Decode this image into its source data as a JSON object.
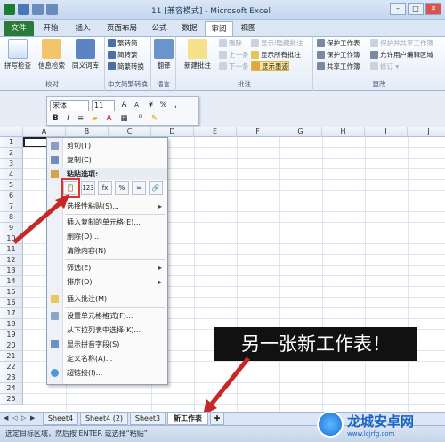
{
  "window": {
    "title": "11  [兼容模式] - Microsoft Excel",
    "min": "–",
    "max": "□",
    "close": "✕"
  },
  "tabs": [
    "文件",
    "开始",
    "插入",
    "页面布局",
    "公式",
    "数据",
    "审阅",
    "视图"
  ],
  "active_tab": "审阅",
  "ribbon": {
    "proofing": {
      "label": "校对",
      "buttons": [
        "拼写检查",
        "信息检索",
        "同义词库"
      ]
    },
    "chinese": {
      "label": "中文简繁转换",
      "buttons": [
        "繁转简",
        "简转繁",
        "简繁转换"
      ]
    },
    "language": {
      "label": "语言",
      "buttons": [
        "翻译"
      ]
    },
    "comments": {
      "label": "批注",
      "new": "新建批注",
      "items": [
        "删除",
        "上一条",
        "下一条",
        "显示/隐藏批注",
        "显示所有批注",
        "显示墨迹"
      ]
    },
    "changes": {
      "label": "更改",
      "items": [
        "保护工作表",
        "保护工作簿",
        "共享工作簿",
        "保护并共享工作簿",
        "允许用户编辑区域",
        "修订 ▾"
      ]
    }
  },
  "format_bar": {
    "font": "宋体",
    "size": "11",
    "bold": "B",
    "italic": "I"
  },
  "grid": {
    "columns": [
      "A",
      "B",
      "C",
      "D",
      "E",
      "F",
      "G",
      "H",
      "I",
      "J"
    ],
    "rows": [
      "1",
      "2",
      "3",
      "4",
      "5",
      "6",
      "7",
      "8",
      "9",
      "10",
      "11",
      "12",
      "13",
      "14",
      "15",
      "16",
      "17",
      "18",
      "19",
      "20",
      "21",
      "22",
      "23",
      "24",
      "25"
    ]
  },
  "context_menu": {
    "items": [
      {
        "label": "剪切(T)"
      },
      {
        "label": "复制(C)"
      },
      {
        "label": "粘贴选项:",
        "header": true
      },
      {
        "label": "选择性粘贴(S)...",
        "arrow": true
      },
      {
        "label": "插入复制的单元格(E)..."
      },
      {
        "label": "删除(D)..."
      },
      {
        "label": "清除内容(N)"
      },
      {
        "label": "筛选(E)",
        "arrow": true
      },
      {
        "label": "排序(O)",
        "arrow": true
      },
      {
        "label": "插入批注(M)"
      },
      {
        "label": "设置单元格格式(F)..."
      },
      {
        "label": "从下拉列表中选择(K)..."
      },
      {
        "label": "显示拼音字段(S)"
      },
      {
        "label": "定义名称(A)..."
      },
      {
        "label": "超链接(I)..."
      }
    ],
    "paste_options": [
      "📋",
      "123",
      "fx",
      "%",
      "∞",
      "🔗"
    ]
  },
  "callout": "另一张新工作表！",
  "sheet_tabs": [
    "Sheet4",
    "Sheet4 (2)",
    "Sheet3",
    "新工作表"
  ],
  "active_sheet": "新工作表",
  "status": "选定目标区域，然后按 ENTER 或选择“粘贴”",
  "watermark": {
    "text": "龙城安卓网",
    "url": "www.lcjrfg.com"
  },
  "colors": {
    "accent": "#2b7a3b",
    "red": "#d33",
    "highlight": "#fde59a"
  }
}
